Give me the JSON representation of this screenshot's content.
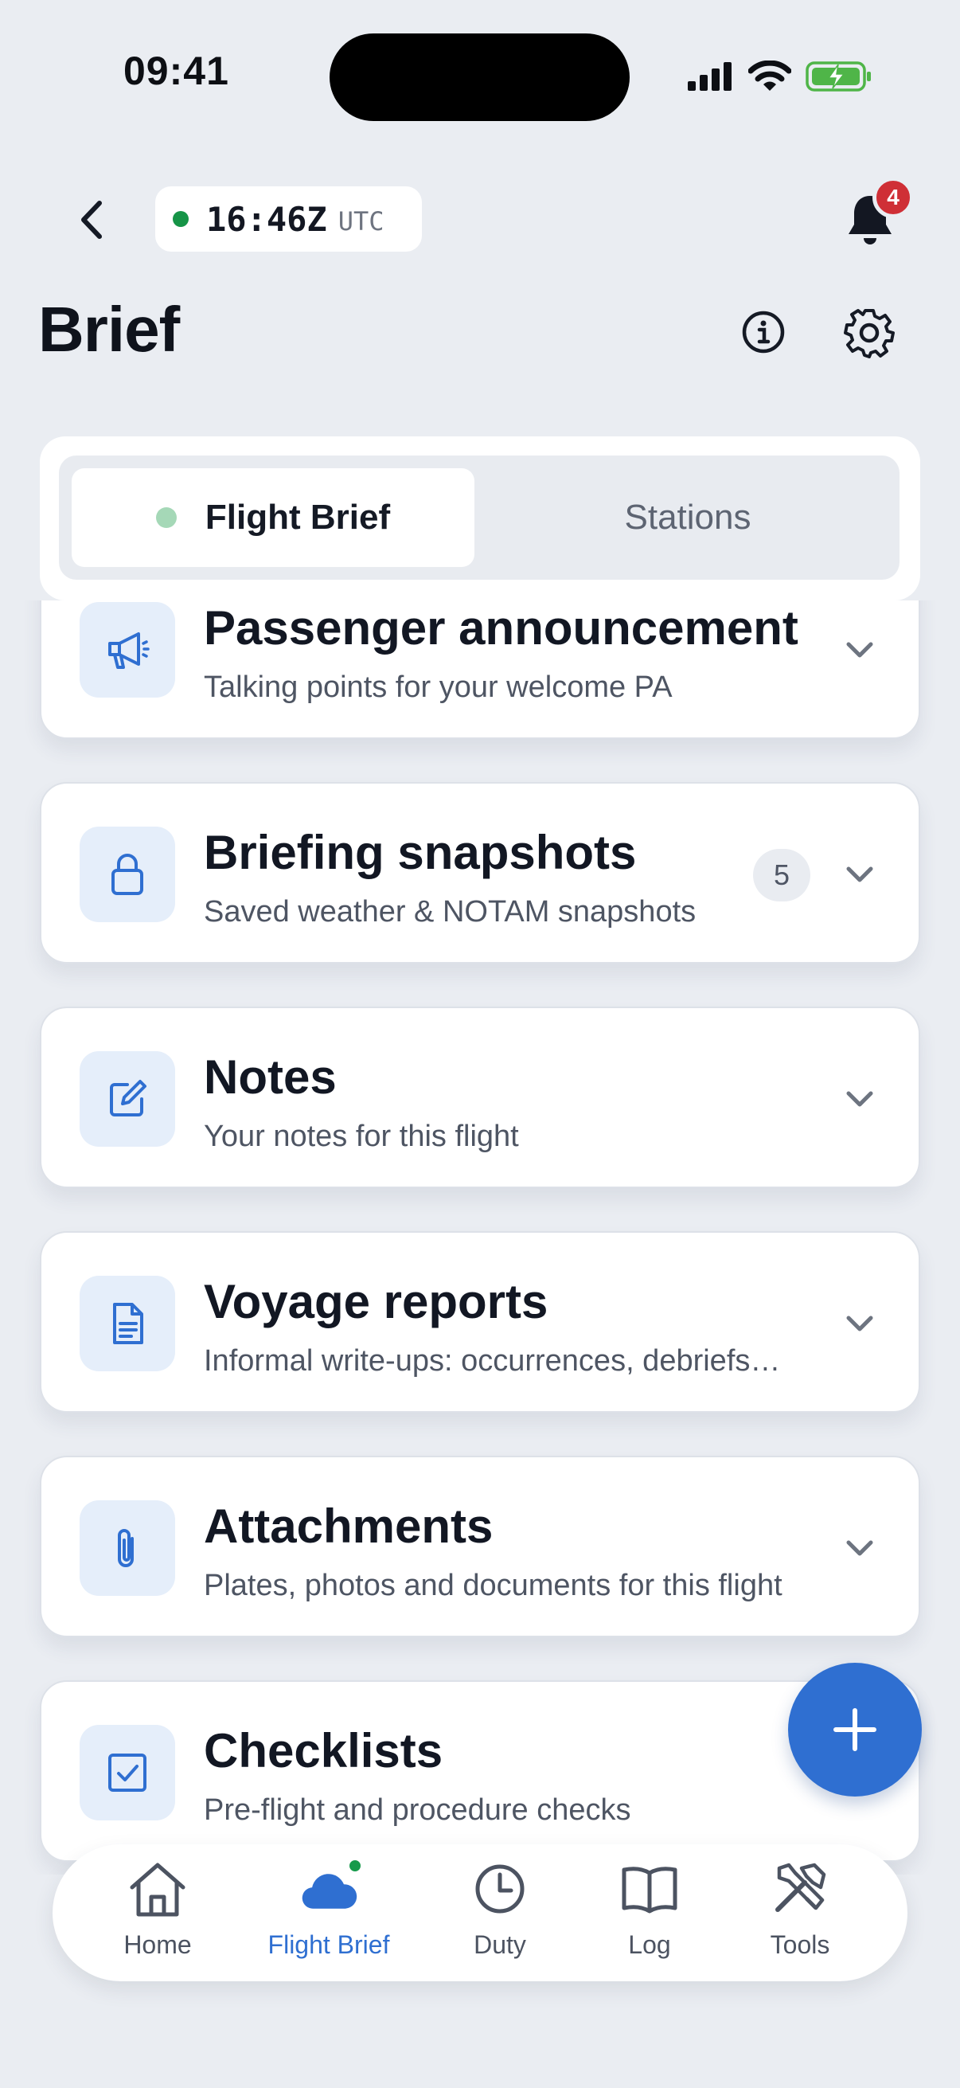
{
  "status_bar": {
    "time": "09:41"
  },
  "header": {
    "clock": {
      "time": "16:46Z",
      "zone": "UTC"
    },
    "notifications_count": "4",
    "title": "Brief"
  },
  "segments": [
    {
      "label": "Flight Brief",
      "active": true
    },
    {
      "label": "Stations",
      "active": false
    }
  ],
  "items": [
    {
      "title": "Passenger announcement",
      "subtitle": "Talking points for your welcome PA",
      "icon": "megaphone-icon"
    },
    {
      "title": "Briefing snapshots",
      "subtitle": "Saved weather & NOTAM snapshots",
      "icon": "lock-icon",
      "badge": "5"
    },
    {
      "title": "Notes",
      "subtitle": "Your notes for this flight",
      "icon": "edit-icon"
    },
    {
      "title": "Voyage reports",
      "subtitle": "Informal write-ups: occurrences, debriefs…",
      "icon": "document-icon"
    },
    {
      "title": "Attachments",
      "subtitle": "Plates, photos and documents for this flight",
      "icon": "paperclip-icon"
    },
    {
      "title": "Checklists",
      "subtitle": "Pre-flight and procedure checks",
      "icon": "checkbox-icon"
    }
  ],
  "tabbar": [
    {
      "label": "Home",
      "icon": "home-icon"
    },
    {
      "label": "Flight Brief",
      "icon": "cloud-icon",
      "active": true
    },
    {
      "label": "Duty",
      "icon": "clock-icon"
    },
    {
      "label": "Log",
      "icon": "book-icon"
    },
    {
      "label": "Tools",
      "icon": "tools-icon"
    }
  ],
  "colors": {
    "accent": "#2f6fd1",
    "online": "#169447",
    "badge": "#cf2f36",
    "background": "#eaedf2"
  }
}
